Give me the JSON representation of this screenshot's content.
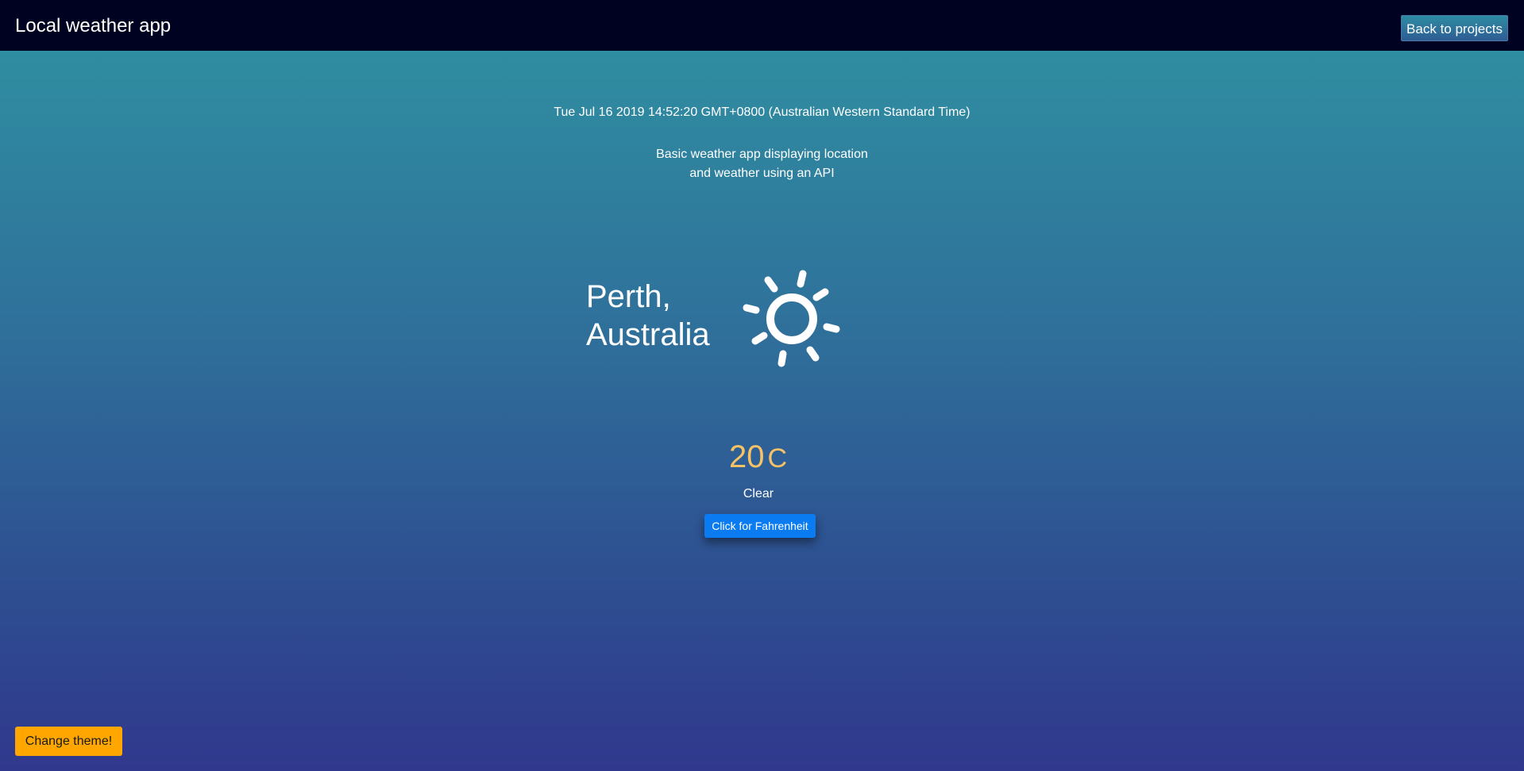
{
  "header": {
    "title": "Local weather app",
    "back_label": "Back to projects"
  },
  "datetime": "Tue Jul 16 2019 14:52:20 GMT+0800 (Australian Western Standard Time)",
  "description": {
    "line1": "Basic weather app displaying location",
    "line2": "and weather using an API"
  },
  "location": {
    "city": "Perth,",
    "country": "Australia"
  },
  "weather": {
    "icon": "sun-icon",
    "temperature": "20",
    "unit": "C",
    "condition": "Clear",
    "toggle_label": "Click for Fahrenheit"
  },
  "theme": {
    "button_label": "Change theme!"
  },
  "colors": {
    "topbar": "#000222",
    "temperature": "#f7c266",
    "toggle_button": "#0a7bf0",
    "theme_button": "#ffa700",
    "gradient_top": "#2f93a2",
    "gradient_bottom": "#30388d"
  }
}
